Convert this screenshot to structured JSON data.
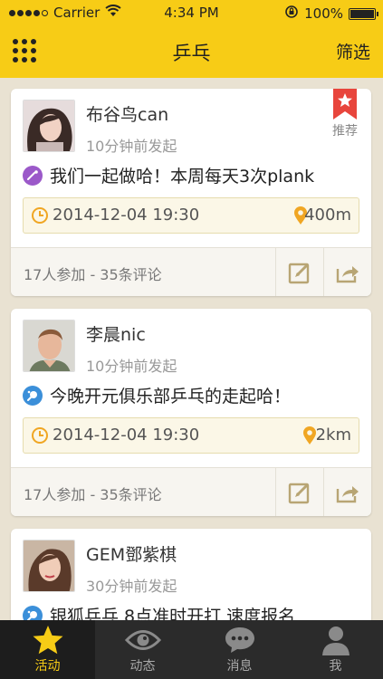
{
  "status_bar": {
    "carrier": "Carrier",
    "time": "4:34 PM",
    "battery": "100%"
  },
  "nav": {
    "title": "乒乓",
    "filter": "筛选"
  },
  "feed": [
    {
      "username": "布谷鸟can",
      "post_time": "10分钟前发起",
      "badge": "推荐",
      "description": "我们一起做哈！本周每天3次plank",
      "date": "2014-12-04  19:30",
      "distance": "400m",
      "stats": "17人参加 - 35条评论"
    },
    {
      "username": "李晨nic",
      "post_time": "10分钟前发起",
      "description": "今晚开元俱乐部乒乓的走起哈！",
      "date": "2014-12-04  19:30",
      "distance": "2km",
      "stats": "17人参加 - 35条评论"
    },
    {
      "username": "GEM鄧紫棋",
      "post_time": "30分钟前发起",
      "description": "银狐乒乓 8点准时开打 速度报名"
    }
  ],
  "tabbar": {
    "items": [
      {
        "label": "活动",
        "icon": "star-icon"
      },
      {
        "label": "动态",
        "icon": "eye-icon"
      },
      {
        "label": "消息",
        "icon": "chat-bubble-icon"
      },
      {
        "label": "我",
        "icon": "person-icon"
      }
    ]
  },
  "colors": {
    "accent": "#f7cc16",
    "background": "#e9e2d2",
    "tabbar": "#2b2b2b",
    "badge_red": "#e8453c",
    "date_icon": "#f0a623"
  }
}
